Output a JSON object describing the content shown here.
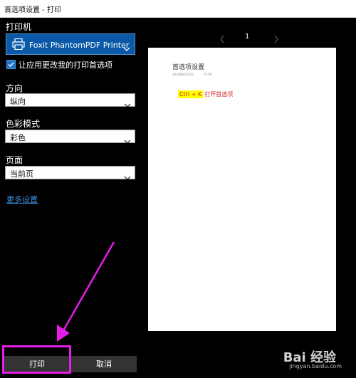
{
  "window": {
    "title": "首选项设置 - 打印"
  },
  "sidebar": {
    "printer_label": "打印机",
    "printer_value": "Foxit PhantomPDF Printer",
    "checkbox_label": "让应用更改我的打印首选项",
    "checkbox_checked": true,
    "orientation": {
      "label": "方向",
      "value": "纵向"
    },
    "color_mode": {
      "label": "色彩模式",
      "value": "彩色"
    },
    "pages": {
      "label": "页面",
      "value": "当前页"
    },
    "more_settings": "更多设置"
  },
  "preview": {
    "page_number": "1",
    "doc_title": "首选项设置",
    "doc_date": "2018年8月10日",
    "doc_time": "21:09",
    "shortcut_highlight": "Ctrl + K",
    "shortcut_text": "打开首选项"
  },
  "buttons": {
    "print": "打印",
    "cancel": "取消"
  },
  "annotation": {
    "highlight_color": "#e61de6"
  },
  "watermark": {
    "main": "Bai 经验",
    "sub": "jingyan.baidu.com"
  }
}
